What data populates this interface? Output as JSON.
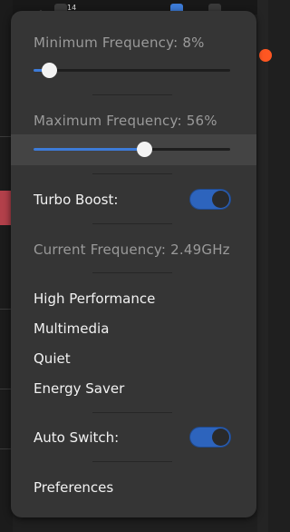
{
  "colors": {
    "accent": "#3d7bd8",
    "popover_bg": "#353535",
    "dim_text": "#9a9a9a"
  },
  "min_freq": {
    "label": "Minimum Frequency:",
    "value": "8%",
    "level": 0.08
  },
  "max_freq": {
    "label": "Maximum Frequency:",
    "value": "56%",
    "level": 0.56
  },
  "turbo": {
    "label": "Turbo Boost:",
    "on": true
  },
  "current": {
    "label": "Current Frequency:",
    "value": "2.49GHz"
  },
  "profiles": [
    "High Performance",
    "Multimedia",
    "Quiet",
    "Energy Saver"
  ],
  "auto_switch": {
    "label": "Auto Switch:",
    "on": true
  },
  "preferences": "Preferences",
  "topbar": {
    "badge": "14"
  }
}
